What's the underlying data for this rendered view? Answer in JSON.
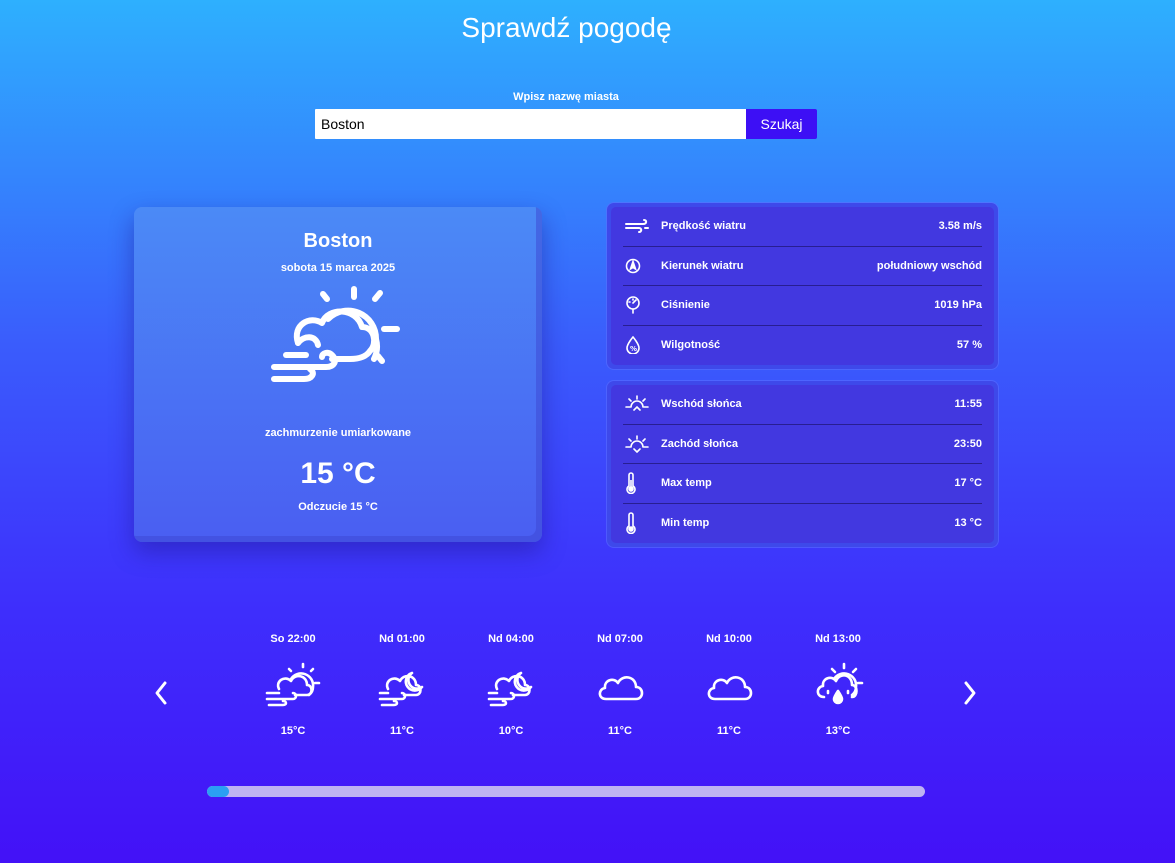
{
  "header": {
    "title": "Sprawdź pogodę"
  },
  "search": {
    "label": "Wpisz nazwę miasta",
    "value": "Boston",
    "placeholder": "",
    "button_label": "Szukaj"
  },
  "current": {
    "city": "Boston",
    "date": "sobota 15 marca 2025",
    "icon": "sun-cloud-wind-icon",
    "description": "zachmurzenie umiarkowane",
    "temperature": "15 °C",
    "feels_like": "Odczucie 15 °C"
  },
  "details": [
    {
      "icon": "wind-icon",
      "label": "Prędkość wiatru",
      "value": "3.58 m/s"
    },
    {
      "icon": "compass-icon",
      "label": "Kierunek wiatru",
      "value": "południowy wschód"
    },
    {
      "icon": "gauge-icon",
      "label": "Ciśnienie",
      "value": "1019 hPa"
    },
    {
      "icon": "humidity-icon",
      "label": "Wilgotność",
      "value": "57 %"
    }
  ],
  "sun_temps": [
    {
      "icon": "sunrise-icon",
      "label": "Wschód słońca",
      "value": "11:55"
    },
    {
      "icon": "sunset-icon",
      "label": "Zachód słońca",
      "value": "23:50"
    },
    {
      "icon": "thermometer-icon",
      "label": "Max temp",
      "value": "17 °C"
    },
    {
      "icon": "thermometer-icon",
      "label": "Min temp",
      "value": "13 °C"
    }
  ],
  "forecast": [
    {
      "time": "So 22:00",
      "icon": "sun-cloud-wind-icon",
      "temp": "15°C"
    },
    {
      "time": "Nd 01:00",
      "icon": "moon-cloud-wind-icon",
      "temp": "11°C"
    },
    {
      "time": "Nd 04:00",
      "icon": "moon-cloud-wind-icon",
      "temp": "10°C"
    },
    {
      "time": "Nd 07:00",
      "icon": "cloud-icon",
      "temp": "11°C"
    },
    {
      "time": "Nd 10:00",
      "icon": "cloud-icon",
      "temp": "11°C"
    },
    {
      "time": "Nd 13:00",
      "icon": "sun-cloud-rain-icon",
      "temp": "13°C"
    }
  ],
  "scrollbar": {
    "position_fraction": 0.03
  },
  "colors": {
    "search_button": "#3d0ff5",
    "scroll_thumb": "#2b9ff3",
    "scroll_track": "#bfb3f2"
  }
}
